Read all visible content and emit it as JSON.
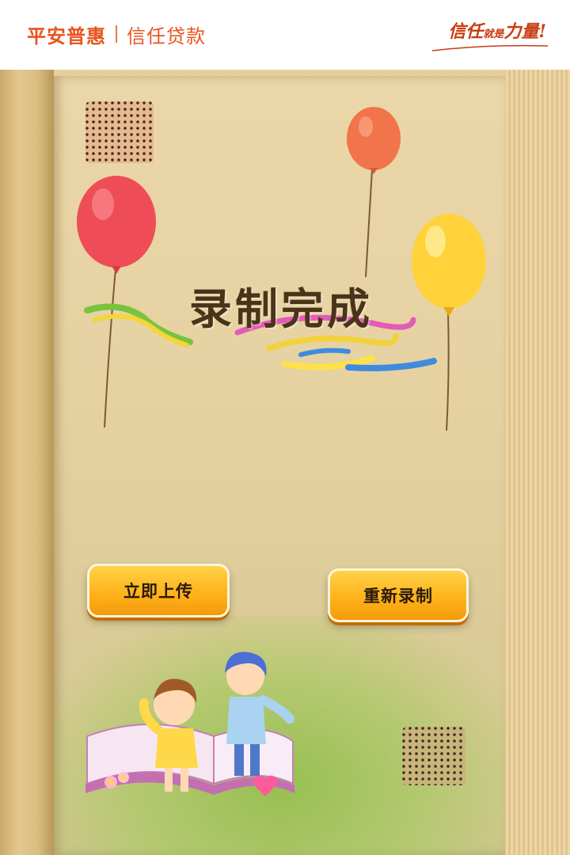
{
  "header": {
    "brand": "平安普惠",
    "brand_sub": "信任贷款",
    "slogan_a": "信任",
    "slogan_b": "就是",
    "slogan_c": "力量!"
  },
  "main": {
    "title": "录制完成",
    "buttons": {
      "upload": "立即上传",
      "rerecord": "重新录制"
    }
  },
  "colors": {
    "brand": "#e8541e",
    "button_top": "#ffd24a",
    "button_bottom": "#f39a0c",
    "title": "#4a3419"
  },
  "icons": [
    "speaker-grille-icon",
    "balloon-red-icon",
    "balloon-orange-icon",
    "balloon-yellow-icon",
    "ribbon-decoration",
    "kids-reading-illustration"
  ]
}
